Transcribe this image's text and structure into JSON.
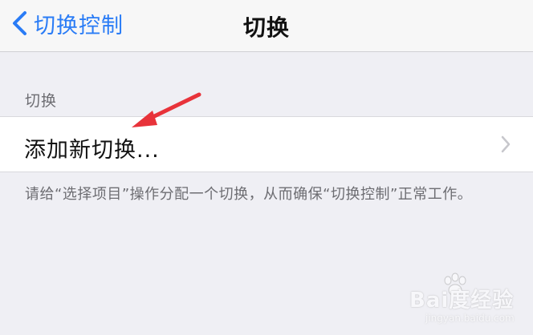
{
  "nav": {
    "back_label": "切换控制",
    "title": "切换"
  },
  "section": {
    "header": "切换",
    "cell_label": "添加新切换...",
    "footer_note": "请给“选择项目”操作分配一个切换，从而确保“切换控制”正常工作。"
  },
  "watermark": {
    "brand": "Bai度经验",
    "url": "jingyan.baidu.com"
  },
  "colors": {
    "accent": "#2a7cf6",
    "background": "#efeff4",
    "annotation_arrow": "#e8333a"
  },
  "icons": {
    "back": "chevron-left-icon",
    "disclosure": "chevron-right-icon",
    "annotation": "red-arrow-icon"
  }
}
